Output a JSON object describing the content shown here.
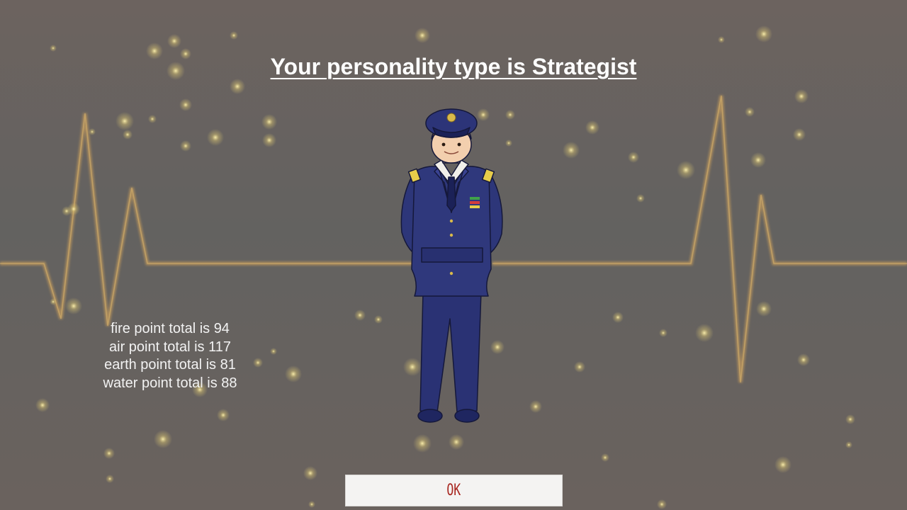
{
  "screen": {
    "title": "Your personality type is Strategist",
    "character": "officer-in-navy-uniform"
  },
  "stats": {
    "fire": "fire point total is 94",
    "air": "air point total is 117",
    "earth": "earth point total is 81",
    "water": "water point total is 88"
  },
  "actions": {
    "ok_label": "OK"
  },
  "colors": {
    "background": "#666260",
    "heartbeat_line": "#c19a5c",
    "sparkle": "#e3d27a",
    "uniform": "#2c3478",
    "ok_text": "#a8261f",
    "ok_background": "#f4f3f2"
  }
}
